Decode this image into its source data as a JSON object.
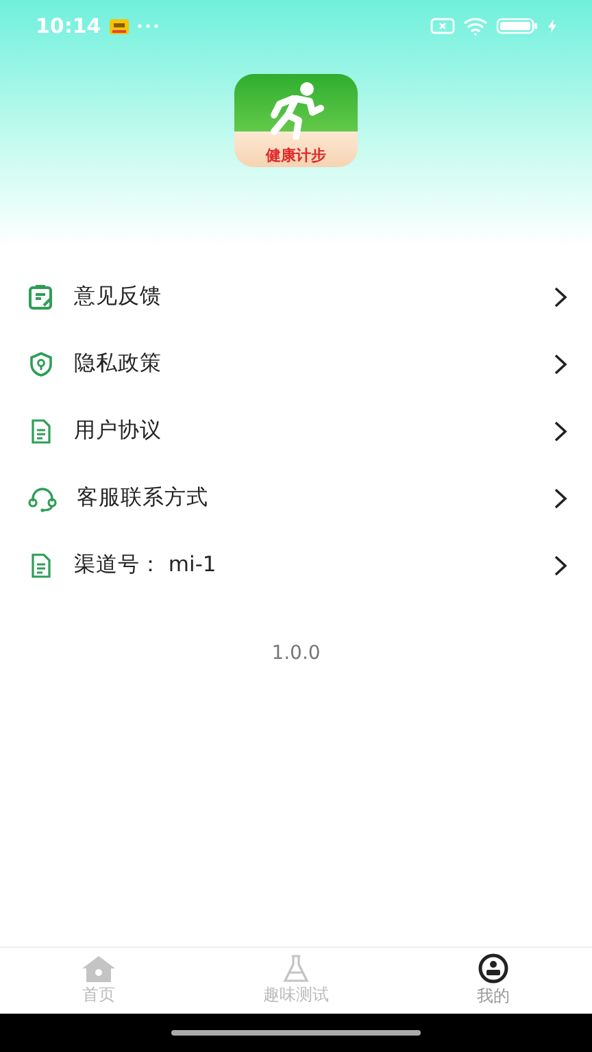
{
  "status_bar": {
    "time": "10:14"
  },
  "app_logo": {
    "label": "健康计步"
  },
  "menu": [
    {
      "kind": "feedback",
      "label": "意见反馈"
    },
    {
      "kind": "privacy",
      "label": "隐私政策"
    },
    {
      "kind": "document",
      "label": "用户协议"
    },
    {
      "kind": "support",
      "label": "客服联系方式"
    },
    {
      "kind": "document",
      "label": "渠道号：  mi-1"
    }
  ],
  "version": "1.0.0",
  "tabs": [
    {
      "kind": "home",
      "label": "首页",
      "selected": false
    },
    {
      "kind": "test",
      "label": "趣味测试",
      "selected": false
    },
    {
      "kind": "me",
      "label": "我的",
      "selected": true
    }
  ]
}
